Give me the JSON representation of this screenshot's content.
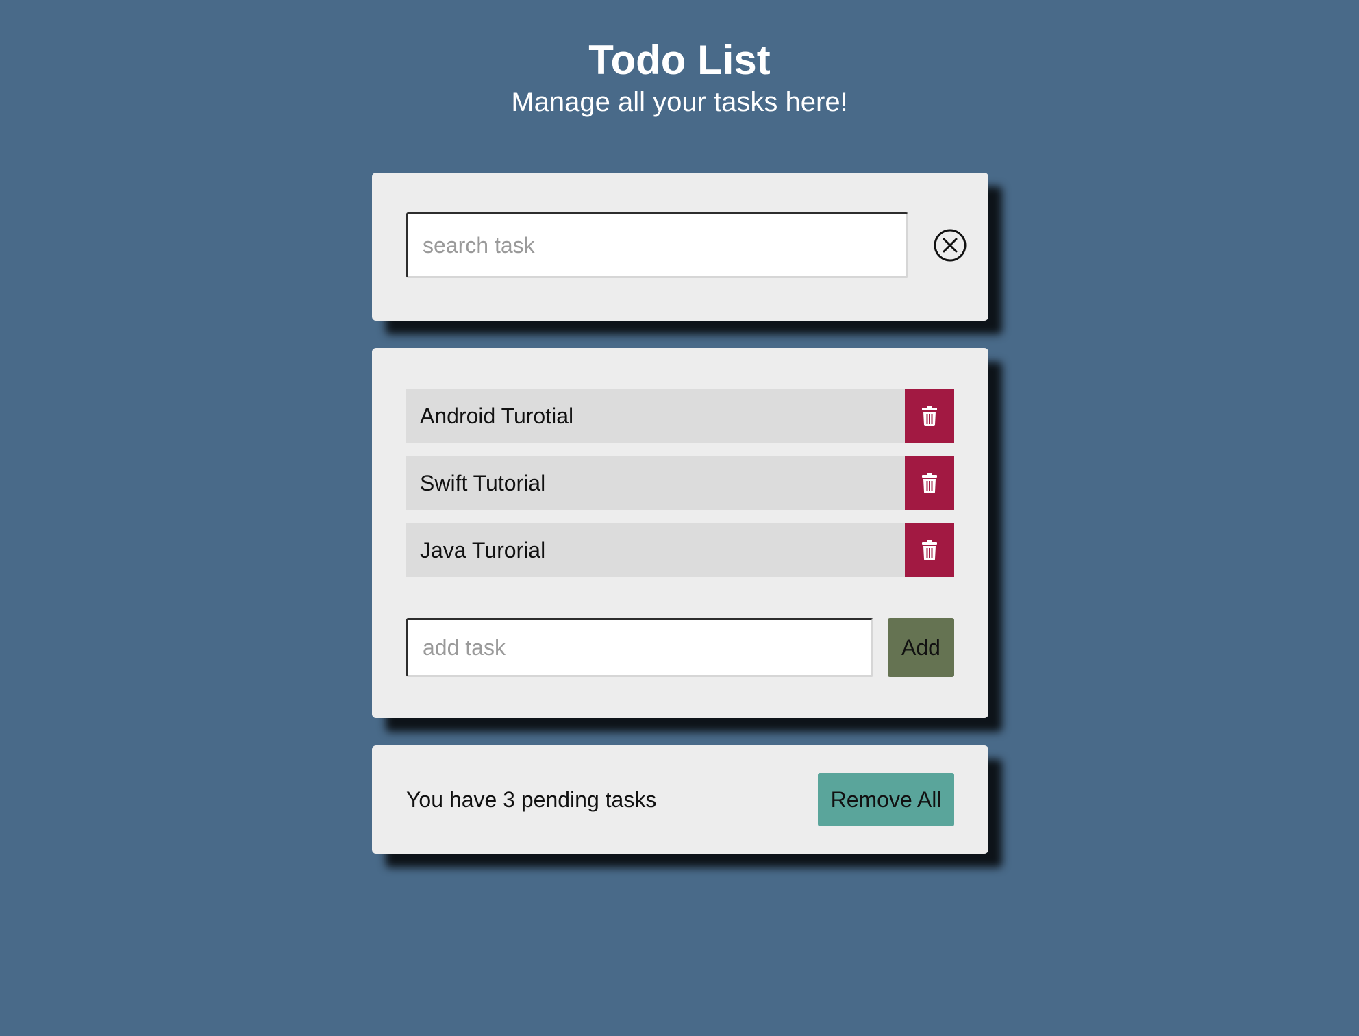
{
  "header": {
    "title": "Todo List",
    "subtitle": "Manage all your tasks here!"
  },
  "search": {
    "placeholder": "search task",
    "value": "",
    "clear_icon": "close-circle-icon"
  },
  "tasks": [
    {
      "label": "Android Turotial",
      "delete_icon": "trash-icon"
    },
    {
      "label": "Swift Tutorial",
      "delete_icon": "trash-icon"
    },
    {
      "label": "Java Turorial",
      "delete_icon": "trash-icon"
    }
  ],
  "add_task": {
    "placeholder": "add task",
    "value": "",
    "button_label": "Add"
  },
  "footer": {
    "pending_text": "You have 3 pending tasks",
    "remove_all_label": "Remove All"
  },
  "colors": {
    "background": "#496a89",
    "card": "#ededed",
    "task_row": "#dcdcdc",
    "delete": "#a21942",
    "add_button": "#657352",
    "remove_all_button": "#5aa59b"
  }
}
